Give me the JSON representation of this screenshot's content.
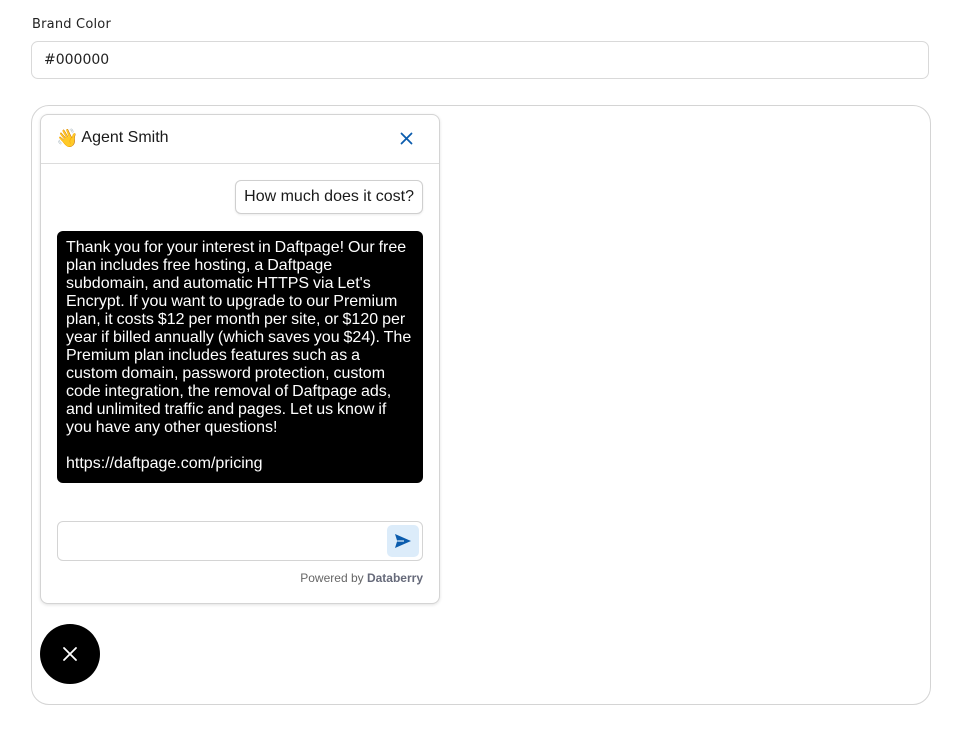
{
  "brand_color": {
    "label": "Brand Color",
    "value": "#000000"
  },
  "chat": {
    "title": "Agent Smith",
    "title_emoji": "👋",
    "close_icon": "close-icon",
    "messages": [
      {
        "role": "user",
        "text": "How much does it cost?"
      },
      {
        "role": "agent",
        "text": "Thank you for your interest in Daftpage! Our free plan includes free hosting, a Daftpage subdomain, and automatic HTTPS via Let's Encrypt. If you want to upgrade to our Premium plan, it costs $12 per month per site, or $120 per year if billed annually (which saves you $24). The Premium plan includes features such as a custom domain, password protection, custom code integration, the removal of Daftpage ads, and unlimited traffic and pages. Let us know if you have any other questions!",
        "link": "https://daftpage.com/pricing"
      }
    ],
    "input": {
      "value": "",
      "placeholder": ""
    },
    "send_icon": "send-icon",
    "powered_by": {
      "prefix": "Powered by",
      "brand": "Databerry"
    }
  },
  "launcher": {
    "icon": "close-icon"
  },
  "colors": {
    "brand": "#000000",
    "accent": "#0b5cad",
    "send_bg": "#dcecfa"
  }
}
